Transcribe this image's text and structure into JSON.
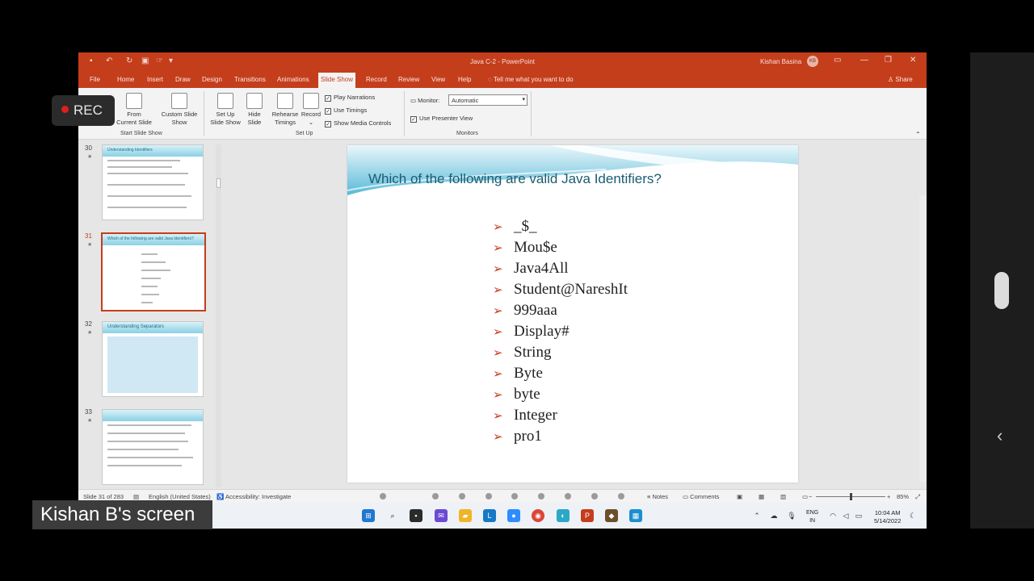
{
  "window": {
    "title": "Java C-2  -  PowerPoint",
    "user_name": "Kishan Basina",
    "user_initials": "KB"
  },
  "menu": [
    "File",
    "Home",
    "Insert",
    "Draw",
    "Design",
    "Transitions",
    "Animations",
    "Slide Show",
    "Record",
    "Review",
    "View",
    "Help"
  ],
  "tell_me": "Tell me what you want to do",
  "share_label": "Share",
  "ribbon": {
    "from_current_line1": "From",
    "from_current_line2": "Current Slide",
    "custom_show_line1": "Custom Slide",
    "custom_show_line2": "Show",
    "group_start": "Start Slide Show",
    "setup_show_line1": "Set Up",
    "setup_show_line2": "Slide Show",
    "hide_slide_line1": "Hide",
    "hide_slide_line2": "Slide",
    "rehearse_line1": "Rehearse",
    "rehearse_line2": "Timings",
    "record": "Record",
    "play_narrations": "Play Narrations",
    "use_timings": "Use Timings",
    "show_media_controls": "Show Media Controls",
    "group_setup": "Set Up",
    "monitor_label": "Monitor:",
    "monitor_value": "Automatic",
    "use_presenter_view": "Use Presenter View",
    "group_monitors": "Monitors"
  },
  "thumbnails": [
    {
      "num": "30",
      "title": "Understanding Identifiers"
    },
    {
      "num": "31",
      "title": "Which of the following are valid Java Identifiers?"
    },
    {
      "num": "32",
      "title": "Understanding Separators"
    },
    {
      "num": "33",
      "title": ""
    }
  ],
  "slide": {
    "title": "Which of the following are valid Java Identifiers?",
    "bullets": [
      "_$_",
      "Mou$e",
      "Java4All",
      "Student@NareshIt",
      "999aaa",
      "Display#",
      "String",
      "Byte",
      "byte",
      "Integer",
      "pro1"
    ]
  },
  "status": {
    "slide_count": "Slide 31 of 283",
    "language": "English (United States)",
    "accessibility": "Accessibility: Investigate",
    "notes": "Notes",
    "comments": "Comments",
    "zoom": "85%"
  },
  "taskbar": {
    "lang_line1": "ENG",
    "lang_line2": "IN",
    "time": "10:04 AM",
    "date": "5/14/2022"
  },
  "overlay": {
    "rec_label": "REC",
    "screen_label": "Kishan B's screen"
  },
  "colors": {
    "accent": "#c43e1c",
    "slide_title": "#1a5c72",
    "bullet_arrow": "#c43e1c"
  }
}
